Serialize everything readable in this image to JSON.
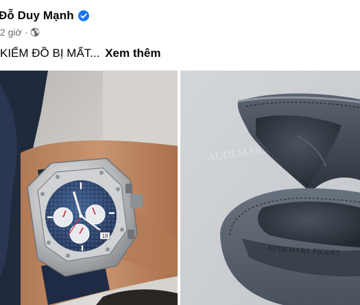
{
  "post": {
    "author": "Đỗ Duy Mạnh",
    "verified_icon": "verified-badge-icon",
    "time": "2 giờ",
    "separator": "·",
    "audience_icon": "globe-icon",
    "caption_text": "KIẾM ĐỒ BỊ MẤT...",
    "see_more": "Xem thêm"
  },
  "photos": [
    {
      "subject": "wristwatch-photo",
      "dial_date": "18"
    },
    {
      "subject": "watch-case-photo",
      "brand_mark": "AUDEMARS PIGUET",
      "watermark": "AUDEMARS"
    }
  ],
  "colors": {
    "verified_blue": "#1877f2",
    "text_primary": "#050505",
    "text_secondary": "#65676b"
  }
}
